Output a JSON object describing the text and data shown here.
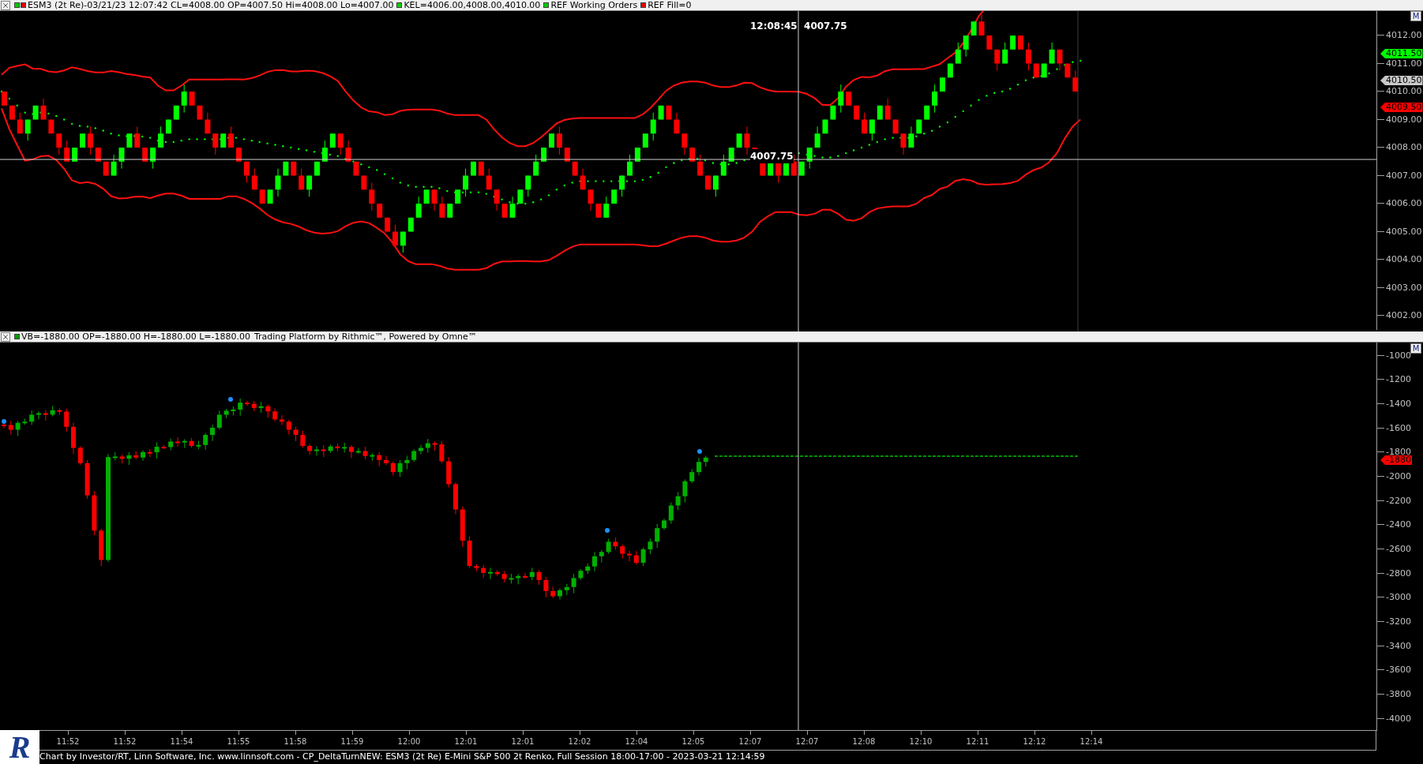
{
  "top_pane": {
    "legend": [
      {
        "text": "ESM3 (2t Re)-03/21/23 12:07:42 CL=4008.00 OP=4007.50 Hi=4008.00 Lo=4007.00",
        "swatches": [
          {
            "color": "#00cc00"
          },
          {
            "color": "#e00000"
          }
        ]
      },
      {
        "text": "KEL=4006.00,4008.00,4010.00",
        "swatches": [
          {
            "color": "#00cc00"
          }
        ]
      },
      {
        "text": "REF Working Orders",
        "swatches": [
          {
            "color": "#00cc00"
          }
        ]
      },
      {
        "text": "REF Fill=0",
        "swatches": [
          {
            "color": "#e00000"
          }
        ]
      }
    ],
    "crosshair_label": "12:08:45  4007.75",
    "cursor_price_label": "4007.75",
    "scale_button": "M",
    "axis_labels": [
      "4012.00",
      "4011.00",
      "4010.00",
      "4009.00",
      "4008.00",
      "4007.00",
      "4006.00",
      "4005.00",
      "4004.00",
      "4003.00",
      "4002.00"
    ],
    "price_tags": [
      {
        "text": "4011.50",
        "color": "#00ff00"
      },
      {
        "text": "4010.50",
        "color": "#c8c8c8"
      },
      {
        "text": "4009.50",
        "color": "#ff0000"
      }
    ]
  },
  "bottom_pane": {
    "legend": [
      {
        "text": "VB=-1880.00 OP=-1880.00 H=-1880.00 L=-1880.00",
        "swatches": [
          {
            "color": "#00a000"
          }
        ]
      },
      {
        "text": "Trading Platform by Rithmic™, Powered by Omne™"
      }
    ],
    "scale_button": "M",
    "axis_labels": [
      "-1000",
      "-1200",
      "-1400",
      "-1600",
      "-1800",
      "-2000",
      "-2200",
      "-2400",
      "-2600",
      "-2800",
      "-3000",
      "-3200",
      "-3400",
      "-3600",
      "-3800",
      "-4000"
    ],
    "price_tags": [
      {
        "text": "-1880",
        "color": "#ff0000"
      }
    ]
  },
  "time_axis": [
    "11:52",
    "11:52",
    "11:54",
    "11:55",
    "11:58",
    "11:59",
    "12:00",
    "12:01",
    "12:01",
    "12:02",
    "12:04",
    "12:05",
    "12:07",
    "12:07",
    "12:08",
    "12:10",
    "12:11",
    "12:12",
    "12:14"
  ],
  "logo": "R",
  "footer": "Chart by Investor/RT, Linn Software, Inc. www.linnsoft.com - CP_DeltaTurnNEW: ESM3 (2t Re) E-Mini S&P 500 2t Renko, Full Session 18:00-17:00 - 2023-03-21 12:14:59"
}
